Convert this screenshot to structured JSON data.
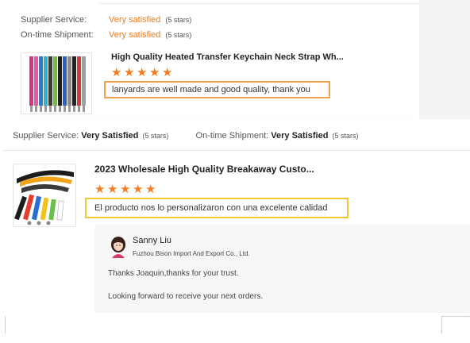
{
  "review1": {
    "supplier_service_label": "Supplier Service:",
    "supplier_service_value": "Very satisfied",
    "supplier_service_stars": "(5 stars)",
    "ontime_label": "On-time Shipment:",
    "ontime_value": "Very satisfied",
    "ontime_stars": "(5 stars)",
    "product_title": "High Quality Heated Transfer Keychain Neck Strap Wh...",
    "rating": 5,
    "comment": "lanyards are well made and good quality, thank you"
  },
  "review2": {
    "supplier_service_label": "Supplier Service:",
    "supplier_service_value": "Very Satisfied",
    "supplier_service_stars": "(5 stars)",
    "ontime_label": "On-time Shipment:",
    "ontime_value": "Very Satisfied",
    "ontime_stars": "(5 stars)",
    "product_title": "2023 Wholesale High Quality Breakaway Custo...",
    "rating": 5,
    "comment": "El producto nos lo personalizaron con una excelente calidad"
  },
  "reply": {
    "name": "Sanny Liu",
    "company": "Fuzhou Bison Import And Export Co., Ltd.",
    "line1": "Thanks Joaquin,thanks for your trust.",
    "line2": "Looking forward to receive your next orders."
  },
  "icons": {
    "star": "star-icon",
    "avatar": "avatar-icon"
  },
  "colors": {
    "accent_orange": "#f27a1a",
    "star_orange": "#f57c20",
    "highlight_orange_box": "#f2a24d",
    "highlight_yellow_box": "#f0c637",
    "reply_bg": "#f6f6f6"
  }
}
